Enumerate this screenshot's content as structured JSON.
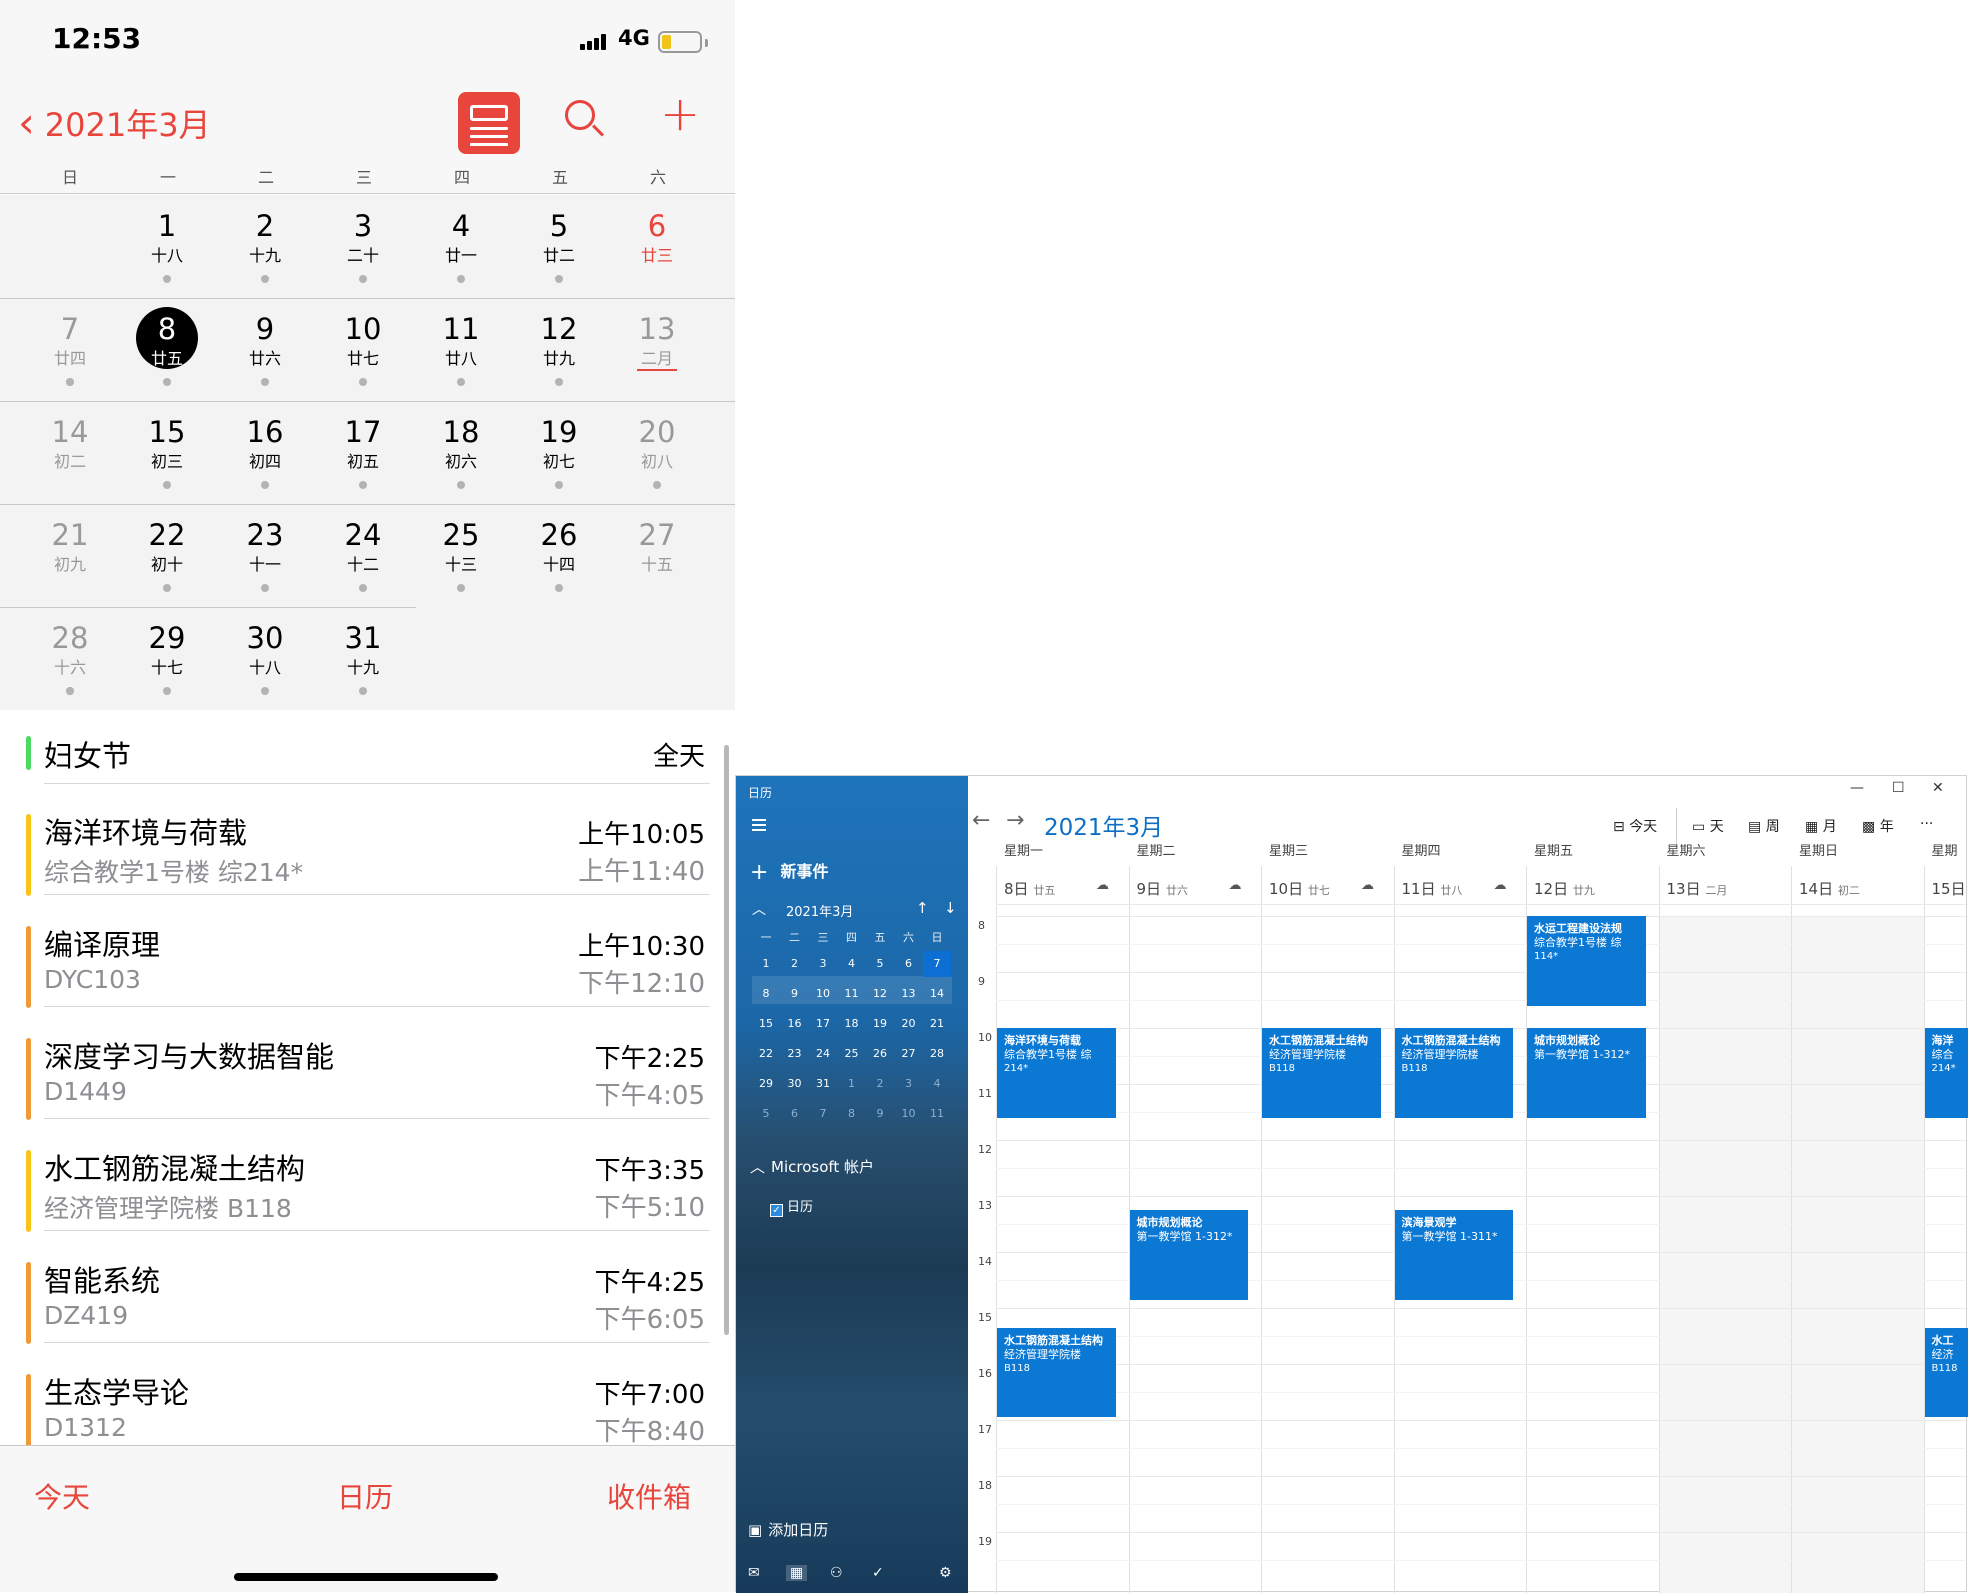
{
  "phone": {
    "status": {
      "time": "12:53",
      "network": "4G"
    },
    "header": {
      "title": "2021年3月"
    },
    "weekdays": [
      "日",
      "一",
      "二",
      "三",
      "四",
      "五",
      "六"
    ],
    "weeks": [
      [
        null,
        {
          "n": "1",
          "l": "十八"
        },
        {
          "n": "2",
          "l": "十九"
        },
        {
          "n": "3",
          "l": "二十"
        },
        {
          "n": "4",
          "l": "廿一"
        },
        {
          "n": "5",
          "l": "廿二"
        },
        {
          "n": "6",
          "l": "廿三"
        }
      ],
      [
        {
          "n": "7",
          "l": "廿四"
        },
        {
          "n": "8",
          "l": "廿五"
        },
        {
          "n": "9",
          "l": "廿六"
        },
        {
          "n": "10",
          "l": "廿七"
        },
        {
          "n": "11",
          "l": "廿八"
        },
        {
          "n": "12",
          "l": "廿九"
        },
        {
          "n": "13",
          "l": "二月"
        }
      ],
      [
        {
          "n": "14",
          "l": "初二"
        },
        {
          "n": "15",
          "l": "初三"
        },
        {
          "n": "16",
          "l": "初四"
        },
        {
          "n": "17",
          "l": "初五"
        },
        {
          "n": "18",
          "l": "初六"
        },
        {
          "n": "19",
          "l": "初七"
        },
        {
          "n": "20",
          "l": "初八"
        }
      ],
      [
        {
          "n": "21",
          "l": "初九"
        },
        {
          "n": "22",
          "l": "初十"
        },
        {
          "n": "23",
          "l": "十一"
        },
        {
          "n": "24",
          "l": "十二"
        },
        {
          "n": "25",
          "l": "十三"
        },
        {
          "n": "26",
          "l": "十四"
        },
        {
          "n": "27",
          "l": "十五"
        }
      ],
      [
        {
          "n": "28",
          "l": "十六"
        },
        {
          "n": "29",
          "l": "十七"
        },
        {
          "n": "30",
          "l": "十八"
        },
        {
          "n": "31",
          "l": "十九"
        },
        null,
        null,
        null
      ]
    ],
    "events": [
      {
        "title": "妇女节",
        "sub": "",
        "t1": "全天",
        "t2": "",
        "color": "#4cd964"
      },
      {
        "title": "海洋环境与荷载",
        "sub": "综合教学1号楼 综214*",
        "t1": "上午10:05",
        "t2": "上午11:40",
        "color": "#f5c518"
      },
      {
        "title": "编译原理",
        "sub": "DYC103",
        "t1": "上午10:30",
        "t2": "下午12:10",
        "color": "#f09a37"
      },
      {
        "title": "深度学习与大数据智能",
        "sub": "D1449",
        "t1": "下午2:25",
        "t2": "下午4:05",
        "color": "#f09a37"
      },
      {
        "title": "水工钢筋混凝土结构",
        "sub": "经济管理学院楼 B118",
        "t1": "下午3:35",
        "t2": "下午5:10",
        "color": "#f5c518"
      },
      {
        "title": "智能系统",
        "sub": "DZ419",
        "t1": "下午4:25",
        "t2": "下午6:05",
        "color": "#f09a37"
      },
      {
        "title": "生态学导论",
        "sub": "D1312",
        "t1": "下午7:00",
        "t2": "下午8:40",
        "color": "#f09a37"
      }
    ],
    "tabs": {
      "today": "今天",
      "calendar": "日历",
      "inbox": "收件箱"
    }
  },
  "windows": {
    "app_title": "日历",
    "new_event": "新事件",
    "mini_month": "2021年3月",
    "mini_weekdays": [
      "一",
      "二",
      "三",
      "四",
      "五",
      "六",
      "日"
    ],
    "mini_days": [
      [
        "1",
        "2",
        "3",
        "4",
        "5",
        "6",
        "7"
      ],
      [
        "8",
        "9",
        "10",
        "11",
        "12",
        "13",
        "14"
      ],
      [
        "15",
        "16",
        "17",
        "18",
        "19",
        "20",
        "21"
      ],
      [
        "22",
        "23",
        "24",
        "25",
        "26",
        "27",
        "28"
      ],
      [
        "29",
        "30",
        "31",
        "1",
        "2",
        "3",
        "4"
      ],
      [
        "5",
        "6",
        "7",
        "8",
        "9",
        "10",
        "11"
      ]
    ],
    "account": "Microsoft 帐户",
    "calendar_name": "日历",
    "add_calendar": "添加日历",
    "month_title": "2021年3月",
    "views": {
      "today": "今天",
      "day": "天",
      "week": "周",
      "month": "月",
      "year": "年",
      "more": "···"
    },
    "days": [
      {
        "week": "星期一",
        "date": "8日",
        "lunar": "廿五"
      },
      {
        "week": "星期二",
        "date": "9日",
        "lunar": "廿六"
      },
      {
        "week": "星期三",
        "date": "10日",
        "lunar": "廿七"
      },
      {
        "week": "星期四",
        "date": "11日",
        "lunar": "廿八"
      },
      {
        "week": "星期五",
        "date": "12日",
        "lunar": "廿九"
      },
      {
        "week": "星期六",
        "date": "13日",
        "lunar": "二月"
      },
      {
        "week": "星期日",
        "date": "14日",
        "lunar": "初二"
      },
      {
        "week": "星期",
        "date": "15日",
        "lunar": ""
      }
    ],
    "hours": [
      "8",
      "9",
      "10",
      "11",
      "12",
      "13",
      "14",
      "15",
      "16",
      "17",
      "18",
      "19"
    ],
    "events": [
      {
        "day": 4,
        "start": 8,
        "end": 9.6,
        "title": "水运工程建设法规",
        "loc": "综合教学1号楼 综",
        "room": "114*"
      },
      {
        "day": 0,
        "start": 10,
        "end": 11.6,
        "title": "海洋环境与荷载",
        "loc": "综合教学1号楼 综",
        "room": "214*"
      },
      {
        "day": 2,
        "start": 10,
        "end": 11.6,
        "title": "水工钢筋混凝土结构",
        "loc": "经济管理学院楼",
        "room": "B118"
      },
      {
        "day": 3,
        "start": 10,
        "end": 11.6,
        "title": "水工钢筋混凝土结构",
        "loc": "经济管理学院楼",
        "room": "B118"
      },
      {
        "day": 4,
        "start": 10,
        "end": 11.6,
        "title": "城市规划概论",
        "loc": "第一教学馆 1-312*",
        "room": ""
      },
      {
        "day": 1,
        "start": 13.25,
        "end": 14.85,
        "title": "城市规划概论",
        "loc": "第一教学馆 1-312*",
        "room": ""
      },
      {
        "day": 3,
        "start": 13.25,
        "end": 14.85,
        "title": "滨海景观学",
        "loc": "第一教学馆 1-311*",
        "room": ""
      },
      {
        "day": 0,
        "start": 15.35,
        "end": 16.95,
        "title": "水工钢筋混凝土结构",
        "loc": "经济管理学院楼",
        "room": "B118"
      },
      {
        "day": 7,
        "start": 10,
        "end": 11.6,
        "title": "海洋",
        "loc": "综合",
        "room": "214*"
      },
      {
        "day": 7,
        "start": 15.35,
        "end": 16.95,
        "title": "水工",
        "loc": "经济",
        "room": "B118"
      }
    ]
  }
}
